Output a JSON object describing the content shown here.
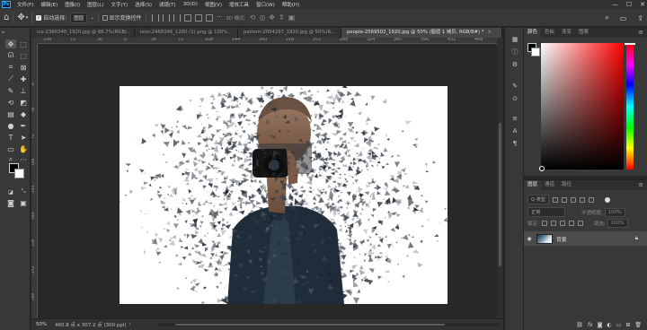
{
  "menubar": {
    "items": [
      "文件(F)",
      "编辑(E)",
      "图像(I)",
      "图层(L)",
      "文字(Y)",
      "选择(S)",
      "滤镜(T)",
      "3D(D)",
      "视图(V)",
      "增效工具",
      "窗口(W)",
      "帮助(H)"
    ],
    "logo": "Ps",
    "minimize": "—",
    "maximize": "☐",
    "close": "✕"
  },
  "options": {
    "auto_select_label": "自动选择:",
    "auto_select_value": "图层",
    "show_transform_label": "显示变换控件",
    "mode_3d_label": "3D 模式:"
  },
  "tabs": [
    {
      "label": "ice-2360348_1920.jpg @ 66.7%(RGB/..."
    },
    {
      "label": "lens-2468346_1280 (1).png @ 100%..."
    },
    {
      "label": "pattern-2054297_1920.jpg @ 50%(R..."
    },
    {
      "label": "people-2569502_1920.jpg @ 50% (图层 1 拷贝, RGB/8#) *"
    }
  ],
  "ruler_top": [
    "108",
    "72",
    "36",
    "0",
    "36",
    "72",
    "108",
    "144",
    "180",
    "216",
    "252",
    "288",
    "324",
    "360",
    "396",
    "432",
    "468",
    "504"
  ],
  "ruler_left": [
    "0",
    "36",
    "72",
    "108",
    "144",
    "180",
    "216",
    "252",
    "288"
  ],
  "status": {
    "zoom": "50%",
    "doc_info": "460.8 点 x 307.2 点 (300 ppi)",
    "arrow": "›"
  },
  "color_panel": {
    "tabs": [
      "颜色",
      "色板",
      "渐变",
      "图案"
    ],
    "menu": "≡"
  },
  "layers_panel": {
    "tabs": [
      "图层",
      "通道",
      "路径"
    ],
    "kind_label": "Q 类型",
    "blend_mode": "正常",
    "opacity_label": "不透明度:",
    "opacity_value": "100%",
    "lock_label": "锁定:",
    "fill_label": "填充:",
    "fill_value": "100%",
    "layers": [
      {
        "name": "背景",
        "visible": true,
        "locked": true
      }
    ]
  },
  "colors": {
    "foreground": "#000000",
    "background": "#ffffff"
  }
}
